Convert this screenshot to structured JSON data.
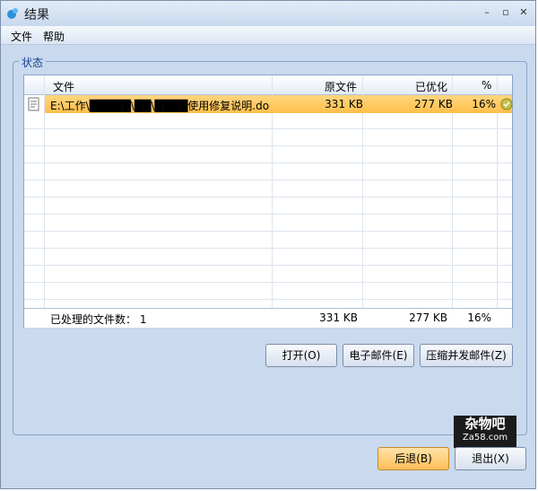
{
  "window": {
    "title": "结果"
  },
  "menu": [
    "文件",
    "帮助"
  ],
  "group": {
    "label": "状态"
  },
  "table": {
    "columns": [
      "文件",
      "原文件",
      "已优化",
      "%"
    ],
    "rows": [
      {
        "file": "E:\\工作\\█████\\██\\████使用修复说明.doc",
        "original": "331 KB",
        "optimized": "277 KB",
        "percent": "16%"
      }
    ],
    "footer": {
      "label": "已处理的文件数： 1",
      "original": "331 KB",
      "optimized": "277 KB",
      "percent": "16%"
    }
  },
  "buttons": {
    "open": "打开(O)",
    "email": "电子邮件(E)",
    "zip_email": "压缩并发邮件(Z)",
    "back": "后退(B)",
    "exit": "退出(X)"
  },
  "watermark": {
    "line1": "杂物吧",
    "line2": "Za58.com"
  },
  "colors": {
    "selected_row": "#ffbf4a",
    "window_bg": "#c9d9ee"
  }
}
